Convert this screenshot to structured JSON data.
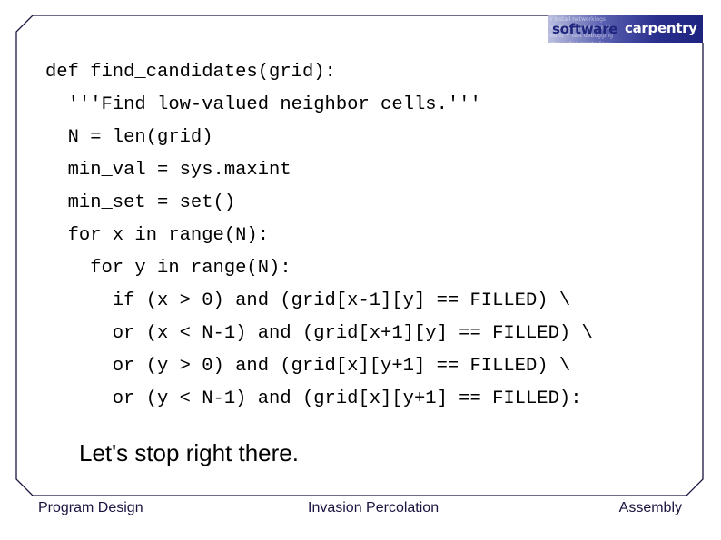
{
  "logo": {
    "word1": "software",
    "word2": "carpentry",
    "background_text": "r install networkings\nversion control scripts\nbuild + test debugging\ndoc + doc create linux"
  },
  "code": {
    "lines": [
      "def find_candidates(grid):",
      "  '''Find low-valued neighbor cells.'''",
      "  N = len(grid)",
      "  min_val = sys.maxint",
      "  min_set = set()",
      "  for x in range(N):",
      "    for y in range(N):",
      "      if (x > 0) and (grid[x-1][y] == FILLED) \\",
      "      or (x < N-1) and (grid[x+1][y] == FILLED) \\",
      "      or (y > 0) and (grid[x][y+1] == FILLED) \\",
      "      or (y < N-1) and (grid[x][y+1] == FILLED):"
    ]
  },
  "remark": "Let's stop right there.",
  "footer": {
    "left": "Program Design",
    "center": "Invasion Percolation",
    "right": "Assembly"
  },
  "colors": {
    "frame": "#1a1540",
    "logo_dark": "#1e2380",
    "footer_text": "#1a1540"
  }
}
